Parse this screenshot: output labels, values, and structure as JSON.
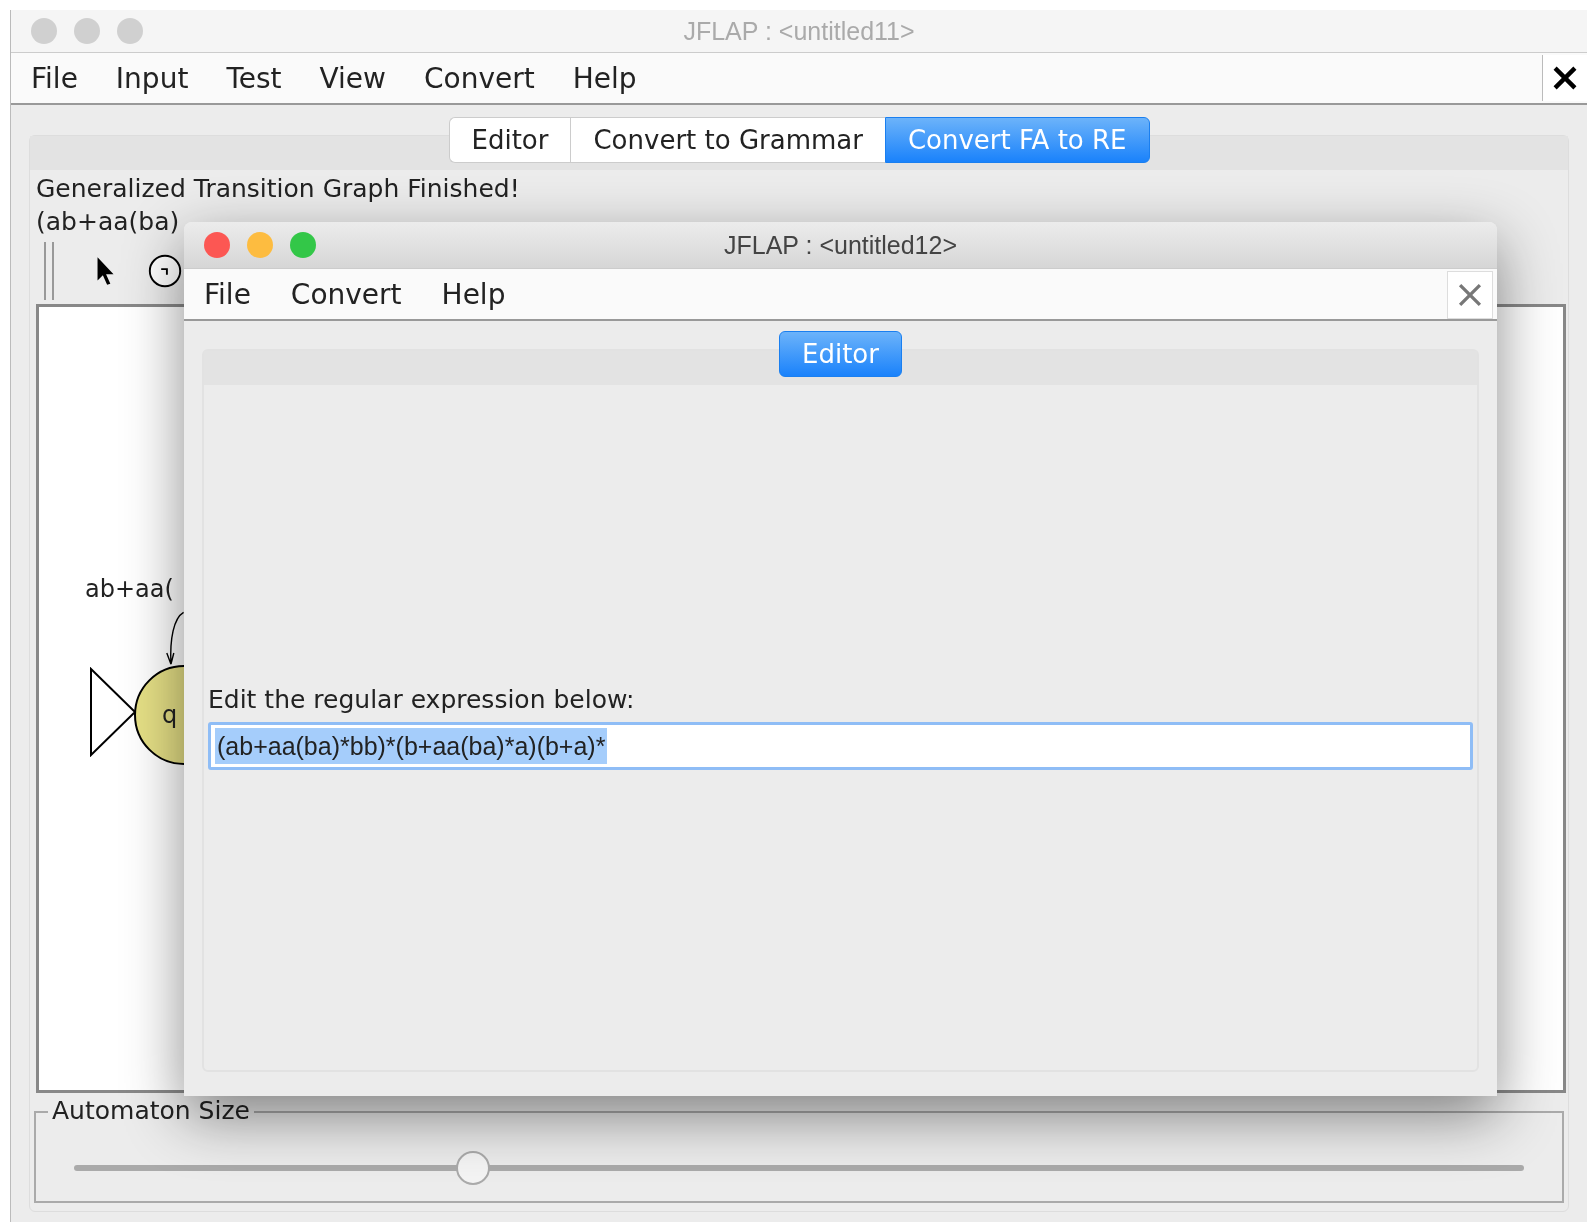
{
  "main_window": {
    "title": "JFLAP : <untitled11>",
    "active": false,
    "menu": [
      "File",
      "Input",
      "Test",
      "View",
      "Convert",
      "Help"
    ],
    "tabs": [
      {
        "label": "Editor",
        "selected": false
      },
      {
        "label": "Convert to Grammar",
        "selected": false
      },
      {
        "label": "Convert FA to RE",
        "selected": true
      }
    ],
    "status": "Generalized Transition Graph Finished!",
    "expression": "(ab+aa(ba)",
    "canvas": {
      "transition_label": "ab+aa(",
      "state_label": "q"
    },
    "size_panel": {
      "title": "Automaton Size",
      "level": 0.275
    }
  },
  "dialog": {
    "title": "JFLAP : <untitled12>",
    "active": true,
    "menu": [
      "File",
      "Convert",
      "Help"
    ],
    "tabs": [
      {
        "label": "Editor",
        "selected": true
      }
    ],
    "prompt": "Edit the regular expression below:",
    "field": {
      "value": "(ab+aa(ba)*bb)*(b+aa(ba)*a)(b+a)*",
      "selected": true
    }
  }
}
